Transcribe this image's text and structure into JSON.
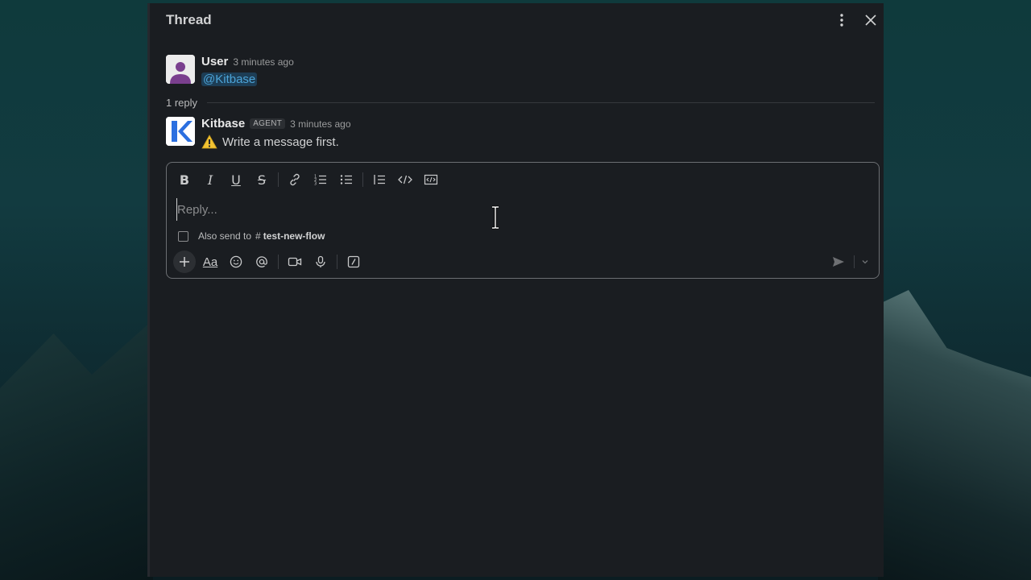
{
  "thread": {
    "title": "Thread"
  },
  "parent_message": {
    "author": "User",
    "time": "3 minutes ago",
    "mention": "@Kitbase"
  },
  "reply_divider": {
    "label": "1 reply"
  },
  "reply_message": {
    "author": "Kitbase",
    "badge": "AGENT",
    "time": "3 minutes ago",
    "text": "Write a message first."
  },
  "composer": {
    "placeholder": "Reply...",
    "also_send_label": "Also send to",
    "channel_hash": "#",
    "channel_name": "test-new-flow",
    "format_label_aa": "Aa"
  },
  "colors": {
    "panel_bg": "#1a1d21",
    "mention_bg": "#1d3d55",
    "mention_text": "#4ca4d8",
    "kitbase_brand": "#2b6fe0",
    "user_avatar": "#7a3f8e"
  },
  "icons": {
    "header": [
      "more-vertical-icon",
      "close-icon"
    ],
    "format_toolbar": [
      "bold-icon",
      "italic-icon",
      "underline-icon",
      "strikethrough-icon",
      "link-icon",
      "ordered-list-icon",
      "bulleted-list-icon",
      "blockquote-icon",
      "code-icon",
      "code-block-icon"
    ],
    "action_toolbar": [
      "plus-icon",
      "formatting-icon",
      "emoji-icon",
      "mention-icon",
      "video-icon",
      "microphone-icon",
      "slash-command-icon"
    ],
    "send": [
      "send-icon",
      "chevron-down-icon"
    ],
    "message": [
      "warning-icon"
    ]
  }
}
